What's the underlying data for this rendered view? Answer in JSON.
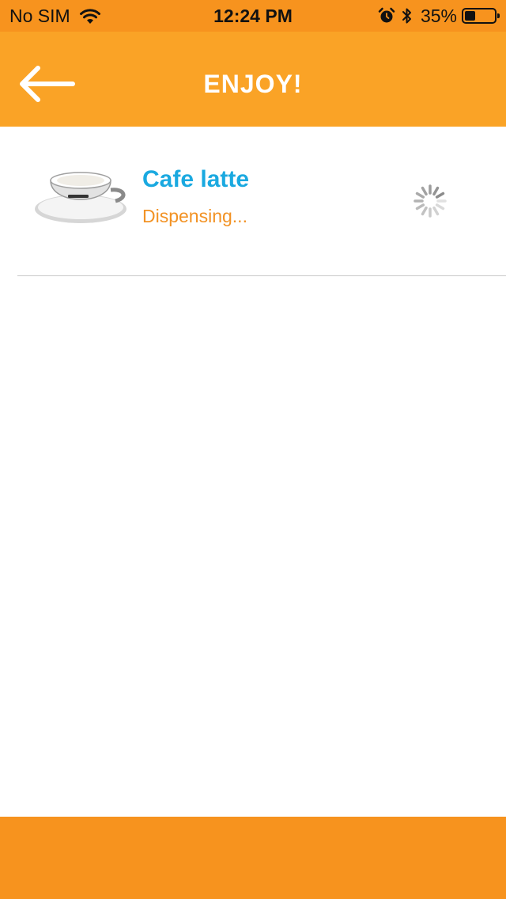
{
  "status_bar": {
    "carrier": "No SIM",
    "time": "12:24 PM",
    "battery_percent": "35%",
    "battery_level": 0.35,
    "icons": [
      "wifi-icon",
      "alarm-icon",
      "bluetooth-icon",
      "battery-icon"
    ]
  },
  "nav": {
    "title": "ENJOY!",
    "back_icon": "arrow-left-icon"
  },
  "order": {
    "items": [
      {
        "name": "Cafe latte",
        "status": "Dispensing...",
        "image": "coffee-cup-image",
        "progress_indicator": "loading-spinner-icon"
      }
    ]
  },
  "colors": {
    "status_bar": "#f7931e",
    "nav_bar": "#faa326",
    "product_name": "#1aa9e0",
    "status_text": "#f29224",
    "bottom_bar": "#f7931e",
    "divider": "#c8c8c8"
  }
}
